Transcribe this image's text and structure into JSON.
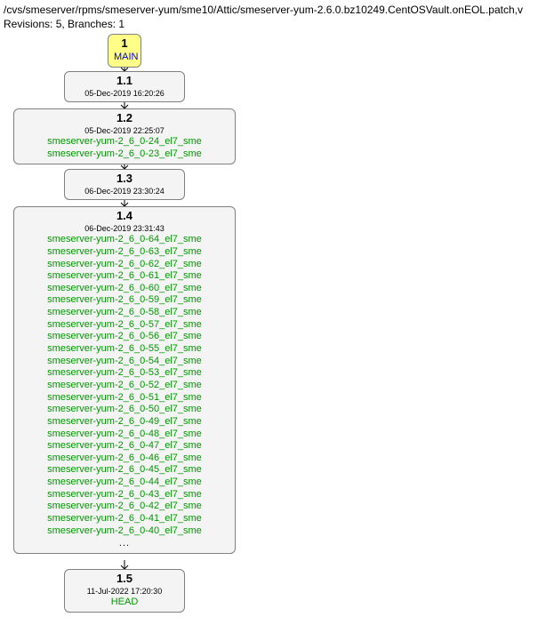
{
  "header": {
    "path": "/cvs/smeserver/rpms/smeserver-yum/sme10/Attic/smeserver-yum-2.6.0.bz10249.CentOSVault.onEOL.patch,v",
    "revisions": "Revisions: 5, Branches: 1"
  },
  "nodes": {
    "main": {
      "rev": "1",
      "label": "MAIN"
    },
    "n11": {
      "rev": "1.1",
      "date": "05-Dec-2019 16:20:26"
    },
    "n12": {
      "rev": "1.2",
      "date": "05-Dec-2019 22:25:07",
      "tags": [
        "smeserver-yum-2_6_0-24_el7_sme",
        "smeserver-yum-2_6_0-23_el7_sme"
      ]
    },
    "n13": {
      "rev": "1.3",
      "date": "06-Dec-2019 23:30:24"
    },
    "n14": {
      "rev": "1.4",
      "date": "06-Dec-2019 23:31:43",
      "tags": [
        "smeserver-yum-2_6_0-64_el7_sme",
        "smeserver-yum-2_6_0-63_el7_sme",
        "smeserver-yum-2_6_0-62_el7_sme",
        "smeserver-yum-2_6_0-61_el7_sme",
        "smeserver-yum-2_6_0-60_el7_sme",
        "smeserver-yum-2_6_0-59_el7_sme",
        "smeserver-yum-2_6_0-58_el7_sme",
        "smeserver-yum-2_6_0-57_el7_sme",
        "smeserver-yum-2_6_0-56_el7_sme",
        "smeserver-yum-2_6_0-55_el7_sme",
        "smeserver-yum-2_6_0-54_el7_sme",
        "smeserver-yum-2_6_0-53_el7_sme",
        "smeserver-yum-2_6_0-52_el7_sme",
        "smeserver-yum-2_6_0-51_el7_sme",
        "smeserver-yum-2_6_0-50_el7_sme",
        "smeserver-yum-2_6_0-49_el7_sme",
        "smeserver-yum-2_6_0-48_el7_sme",
        "smeserver-yum-2_6_0-47_el7_sme",
        "smeserver-yum-2_6_0-46_el7_sme",
        "smeserver-yum-2_6_0-45_el7_sme",
        "smeserver-yum-2_6_0-44_el7_sme",
        "smeserver-yum-2_6_0-43_el7_sme",
        "smeserver-yum-2_6_0-42_el7_sme",
        "smeserver-yum-2_6_0-41_el7_sme",
        "smeserver-yum-2_6_0-40_el7_sme"
      ],
      "ellipsis": "..."
    },
    "n15": {
      "rev": "1.5",
      "date": "11-Jul-2022 17:20:30",
      "head": "HEAD"
    }
  }
}
